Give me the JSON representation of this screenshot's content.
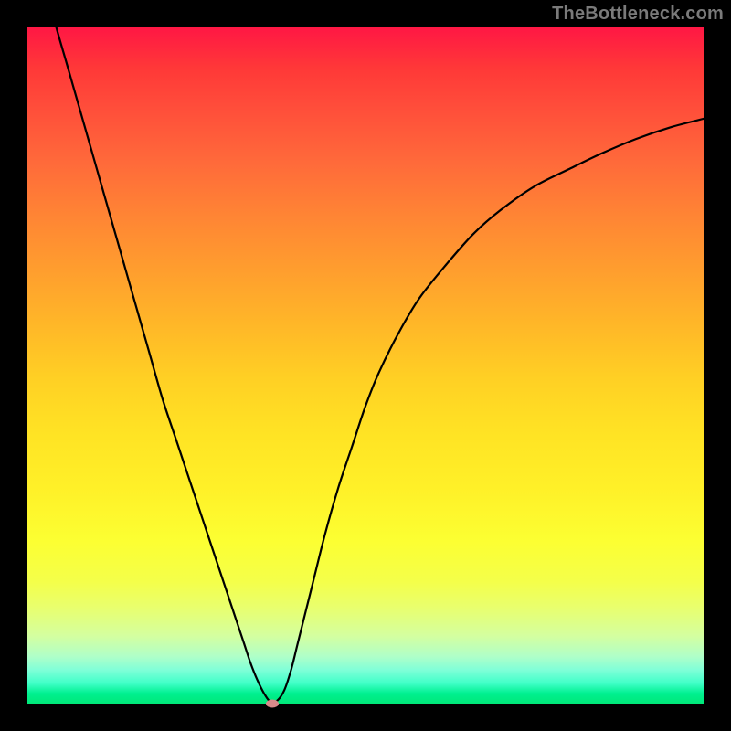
{
  "watermark": "TheBottleneck.com",
  "colors": {
    "background": "#000000",
    "curve": "#000000",
    "marker": "#d98a8a",
    "gradient_top": "#ff1744",
    "gradient_mid": "#ffe324",
    "gradient_bottom": "#00e878"
  },
  "chart_data": {
    "type": "line",
    "title": "",
    "xlabel": "",
    "ylabel": "",
    "xlim": [
      0,
      100
    ],
    "ylim": [
      0,
      100
    ],
    "x": [
      0,
      2,
      4,
      6,
      8,
      10,
      12,
      14,
      16,
      18,
      20,
      22,
      24,
      26,
      28,
      30,
      31,
      32,
      33,
      34,
      35,
      36,
      37,
      38,
      39,
      40,
      42,
      44,
      46,
      48,
      50,
      52,
      55,
      58,
      62,
      66,
      70,
      75,
      80,
      85,
      90,
      95,
      100
    ],
    "values": [
      120,
      109,
      101,
      94,
      87,
      80,
      73,
      66,
      59,
      52,
      45,
      39,
      33,
      27,
      21,
      15,
      12,
      9,
      6,
      3.5,
      1.5,
      0.2,
      0.5,
      2,
      5,
      9,
      17,
      25,
      32,
      38,
      44,
      49,
      55,
      60,
      65,
      69.5,
      73,
      76.5,
      79,
      81.4,
      83.5,
      85.2,
      86.5
    ],
    "minimum": {
      "x": 36.2,
      "y": 0
    },
    "grid": false,
    "legend": false
  }
}
